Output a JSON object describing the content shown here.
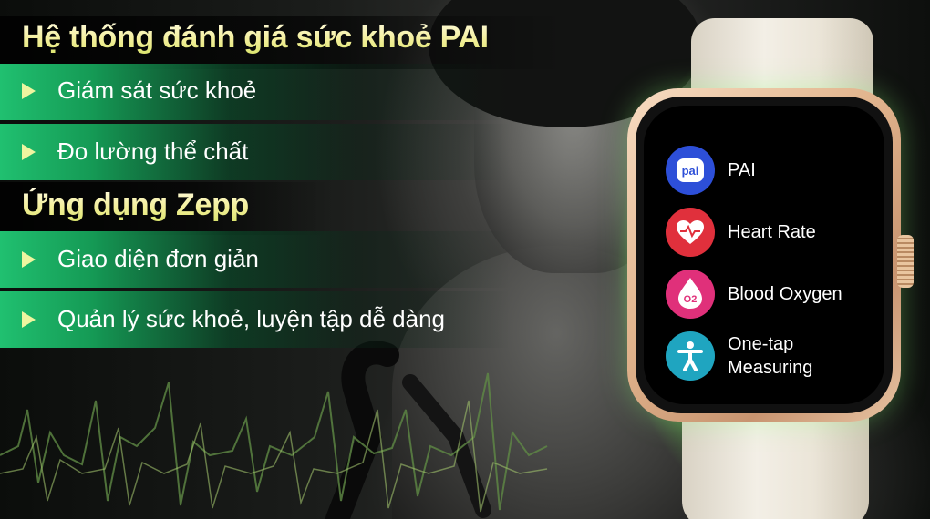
{
  "section1": {
    "title": "Hệ thống đánh giá sức khoẻ PAI",
    "items": [
      "Giám sát sức khoẻ",
      "Đo lường thể chất"
    ]
  },
  "section2": {
    "title": "Ứng dụng Zepp",
    "items": [
      "Giao diện đơn giản",
      "Quản lý sức khoẻ, luyện tập dễ dàng"
    ]
  },
  "watch": {
    "apps": [
      {
        "label": "PAI",
        "icon": "pai-icon",
        "color": "#2d4fd8",
        "icon_text": "pai"
      },
      {
        "label": "Heart Rate",
        "icon": "heart-icon",
        "color": "#e0303c"
      },
      {
        "label": "Blood Oxygen",
        "icon": "blood-oxygen-icon",
        "color": "#e0307a",
        "icon_text": "O2"
      },
      {
        "label": "One-tap\nMeasuring",
        "icon": "person-icon",
        "color": "#1fa5c0"
      }
    ]
  },
  "colors": {
    "accent_green": "#1fc06f",
    "title_yellow": "#f3ef9a",
    "arrow": "#eef5a0"
  }
}
